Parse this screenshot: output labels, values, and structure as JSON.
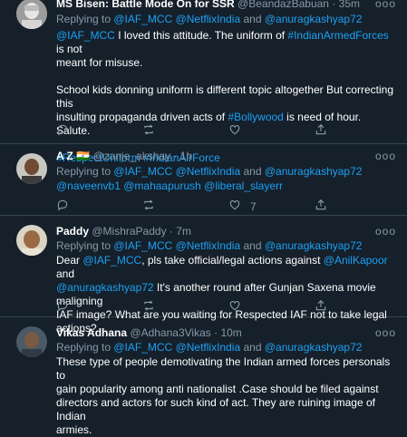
{
  "tweets": [
    {
      "name": "MS Bisen: Battle Mode On for SSR",
      "handle": "@BeandazBabuan",
      "time": "35m",
      "replying_prefix": "Replying to ",
      "replying_to": [
        "@IAF_MCC",
        "@NetflixIndia",
        "and",
        "@anuragkashyap72"
      ],
      "lines": [
        [
          {
            "t": "@IAF_MCC",
            "link": true
          },
          {
            "t": " I loved this attitude. The uniform of "
          },
          {
            "t": "#IndianArmedForces",
            "link": true
          },
          {
            "t": " is not"
          }
        ],
        [
          {
            "t": "meant for misuse."
          }
        ],
        [],
        [
          {
            "t": "School kids donning uniform is different topic altogether But correcting this"
          }
        ],
        [
          {
            "t": "insulting propaganda driven acts of "
          },
          {
            "t": "#Bollywood",
            "link": true
          },
          {
            "t": " is need of hour. Salute."
          }
        ],
        [],
        [
          {
            "t": "#RespectUniform #IndianAirForce",
            "link": true
          }
        ]
      ],
      "like_count": ""
    },
    {
      "name": "A Z",
      "flag": "🇮🇳",
      "handle": "@zanje_akshay",
      "time": "1h",
      "replying_prefix": "Replying to ",
      "replying_to": [
        "@IAF_MCC",
        "@NetflixIndia",
        "and",
        "@anuragkashyap72"
      ],
      "lines": [
        [
          {
            "t": "@naveenvb1 @mahaapurush @liberal_slayerr",
            "link": true
          }
        ]
      ],
      "like_count": "7"
    },
    {
      "name": "Paddy",
      "handle": "@MishraPaddy",
      "time": "7m",
      "replying_prefix": "Replying to ",
      "replying_to": [
        "@IAF_MCC",
        "@NetflixIndia",
        "and",
        "@anuragkashyap72"
      ],
      "lines": [
        [
          {
            "t": "Dear "
          },
          {
            "t": "@IAF_MCC",
            "link": true
          },
          {
            "t": ", pls take official/legal actions against "
          },
          {
            "t": "@AnilKapoor",
            "link": true
          },
          {
            "t": " and"
          }
        ],
        [
          {
            "t": "@anuragkashyap72",
            "link": true
          },
          {
            "t": " It's another round after Gunjan Saxena movie maligning"
          }
        ],
        [
          {
            "t": "IAF image? What are you waiting for Respected IAF not to take legal actions?"
          }
        ]
      ],
      "like_count": ""
    },
    {
      "name": "Vikas Adhana",
      "handle": "@Adhana3Vikas",
      "time": "10m",
      "replying_prefix": "Replying to ",
      "replying_to": [
        "@IAF_MCC",
        "@NetflixIndia",
        "and",
        "@anuragkashyap72"
      ],
      "lines": [
        [
          {
            "t": "These type of people demotivating the Indian armed forces personals to"
          }
        ],
        [
          {
            "t": "gain  popularity among anti nationalist .Case should be filed against"
          }
        ],
        [
          {
            "t": "directors and actors for such kind of act. They are ruining image of Indian"
          }
        ],
        [
          {
            "t": "armies."
          }
        ]
      ],
      "like_count": ""
    }
  ],
  "more_label": "ooo",
  "dot": "·",
  "colors": {
    "background": "#15202b",
    "link": "#1da1f2",
    "muted": "#8899a6",
    "divider": "#38444d"
  }
}
